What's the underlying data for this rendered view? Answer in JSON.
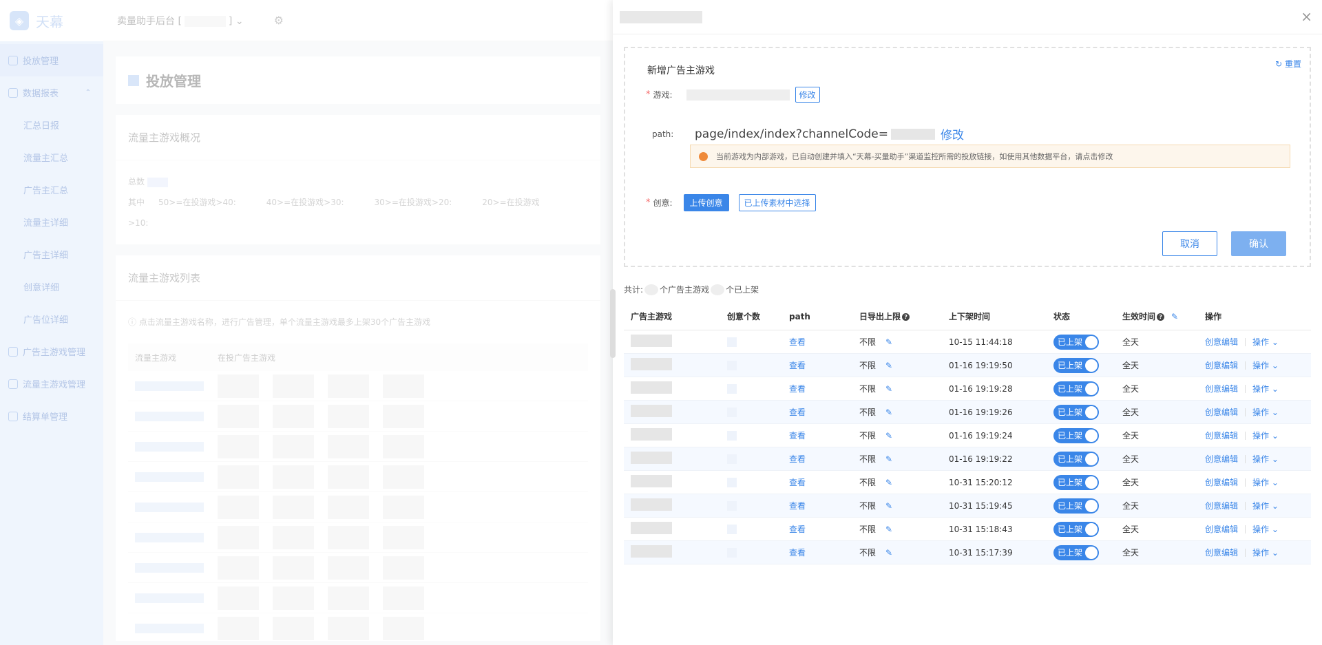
{
  "brand": {
    "name": "天幕"
  },
  "topbar": {
    "title": "卖量助手后台 [",
    "title_suffix": "]"
  },
  "sidebar": {
    "items": [
      {
        "label": "投放管理",
        "active": true,
        "sub": false,
        "icon": "monitor-icon"
      },
      {
        "label": "数据报表",
        "active": false,
        "sub": false,
        "icon": "chart-line-icon",
        "chevron": "⌃"
      },
      {
        "label": "汇总日报",
        "active": false,
        "sub": true
      },
      {
        "label": "流量主汇总",
        "active": false,
        "sub": true
      },
      {
        "label": "广告主汇总",
        "active": false,
        "sub": true
      },
      {
        "label": "流量主详细",
        "active": false,
        "sub": true
      },
      {
        "label": "广告主详细",
        "active": false,
        "sub": true
      },
      {
        "label": "创意详细",
        "active": false,
        "sub": true
      },
      {
        "label": "广告位详细",
        "active": false,
        "sub": true
      },
      {
        "label": "广告主游戏管理",
        "active": false,
        "sub": false,
        "icon": "user-icon"
      },
      {
        "label": "流量主游戏管理",
        "active": false,
        "sub": false,
        "icon": "user-icon"
      },
      {
        "label": "结算单管理",
        "active": false,
        "sub": false,
        "icon": "document-icon"
      }
    ]
  },
  "main": {
    "page_title": "投放管理",
    "overview_title": "流量主游戏概况",
    "overview_total": "总数",
    "overview_breakdown": {
      "prefix": "其中",
      "items": [
        "50>=在投游戏>40:",
        "40>=在投游戏>30:",
        "30>=在投游戏>20:",
        "20>=在投游戏>10:"
      ]
    },
    "list_title": "流量主游戏列表",
    "list_hint": "ⓘ 点击流量主游戏名称，进行广告管理，单个流量主游戏最多上架30个广告主游戏",
    "list_headers": [
      "流量主游戏",
      "在投广告主游戏"
    ]
  },
  "drawer": {
    "close": "×",
    "form": {
      "title": "新增广告主游戏",
      "reset": "↻ 重置",
      "game_label": "游戏:",
      "game_edit": "修改",
      "path_label": "path:",
      "path_value": "page/index/index?channelCode=",
      "path_edit": "修改",
      "alert": "当前游戏为内部游戏，已自动创建并填入“天幕-买量助手”渠道监控所需的投放链接，如使用其他数据平台，请点击修改",
      "creative_label": "创意:",
      "upload_btn": "上传创意",
      "choose_btn": "已上传素材中选择",
      "cancel": "取消",
      "confirm": "确认"
    },
    "count": {
      "prefix": "共计:",
      "mid": "个广告主游戏",
      "suffix": "个已上架"
    },
    "table": {
      "headers": [
        "广告主游戏",
        "创意个数",
        "path",
        "日导出上限",
        "上下架时间",
        "状态",
        "生效时间",
        "操作"
      ],
      "rows": [
        {
          "limit": "不限",
          "time": "10-15 11:44:18",
          "status": "已上架",
          "effect": "全天"
        },
        {
          "limit": "不限",
          "time": "01-16 19:19:50",
          "status": "已上架",
          "effect": "全天"
        },
        {
          "limit": "不限",
          "time": "01-16 19:19:28",
          "status": "已上架",
          "effect": "全天"
        },
        {
          "limit": "不限",
          "time": "01-16 19:19:26",
          "status": "已上架",
          "effect": "全天"
        },
        {
          "limit": "不限",
          "time": "01-16 19:19:24",
          "status": "已上架",
          "effect": "全天"
        },
        {
          "limit": "不限",
          "time": "01-16 19:19:22",
          "status": "已上架",
          "effect": "全天"
        },
        {
          "limit": "不限",
          "time": "10-31 15:20:12",
          "status": "已上架",
          "effect": "全天"
        },
        {
          "limit": "不限",
          "time": "10-31 15:19:45",
          "status": "已上架",
          "effect": "全天"
        },
        {
          "limit": "不限",
          "time": "10-31 15:18:43",
          "status": "已上架",
          "effect": "全天"
        },
        {
          "limit": "不限",
          "time": "10-31 15:17:39",
          "status": "已上架",
          "effect": "全天"
        }
      ],
      "view_label": "查看",
      "edit_label": "创意编辑",
      "op_label": "操作 ⌄"
    }
  }
}
